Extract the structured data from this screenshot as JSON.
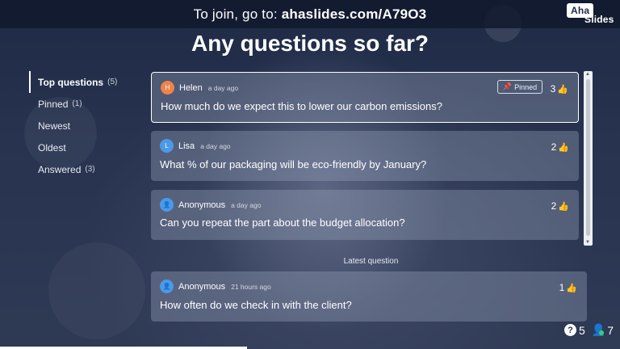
{
  "header": {
    "join_text": "To join, go to:",
    "join_code": "ahaslides.com/A79O3",
    "logo_top": "Aha",
    "logo_bottom": "Slides"
  },
  "page_title": "Any questions so far?",
  "sidebar": {
    "items": [
      {
        "label": "Top questions",
        "count": "(5)",
        "active": true
      },
      {
        "label": "Pinned",
        "count": "(1)"
      },
      {
        "label": "Newest",
        "count": ""
      },
      {
        "label": "Oldest",
        "count": ""
      },
      {
        "label": "Answered",
        "count": "(3)"
      }
    ]
  },
  "questions": [
    {
      "initial": "H",
      "avatar_color": "#f0834a",
      "author": "Helen",
      "time": "a day ago",
      "text": "How much do we expect this to lower our carbon emissions?",
      "votes": "3",
      "pinned_label": "Pinned"
    },
    {
      "initial": "L",
      "avatar_color": "#4a9ae8",
      "author": "Lisa",
      "time": "a day ago",
      "text": "What % of our packaging will be eco-friendly by January?",
      "votes": "2"
    },
    {
      "initial": "",
      "avatar_color": "#4a9ae8",
      "author": "Anonymous",
      "time": "a day ago",
      "text": "Can you repeat the part about the budget allocation?",
      "votes": "2"
    }
  ],
  "latest": {
    "label": "Latest question",
    "question": {
      "author": "Anonymous",
      "avatar_color": "#4a9ae8",
      "time": "21 hours ago",
      "text": "How often do we check in with the client?",
      "votes": "1"
    }
  },
  "stats": {
    "questions_count": "5",
    "participants_count": "7"
  },
  "icons": {
    "thumb": "thumbs-up-icon",
    "pin": "pin-icon",
    "question": "question-icon",
    "user": "user-icon"
  }
}
